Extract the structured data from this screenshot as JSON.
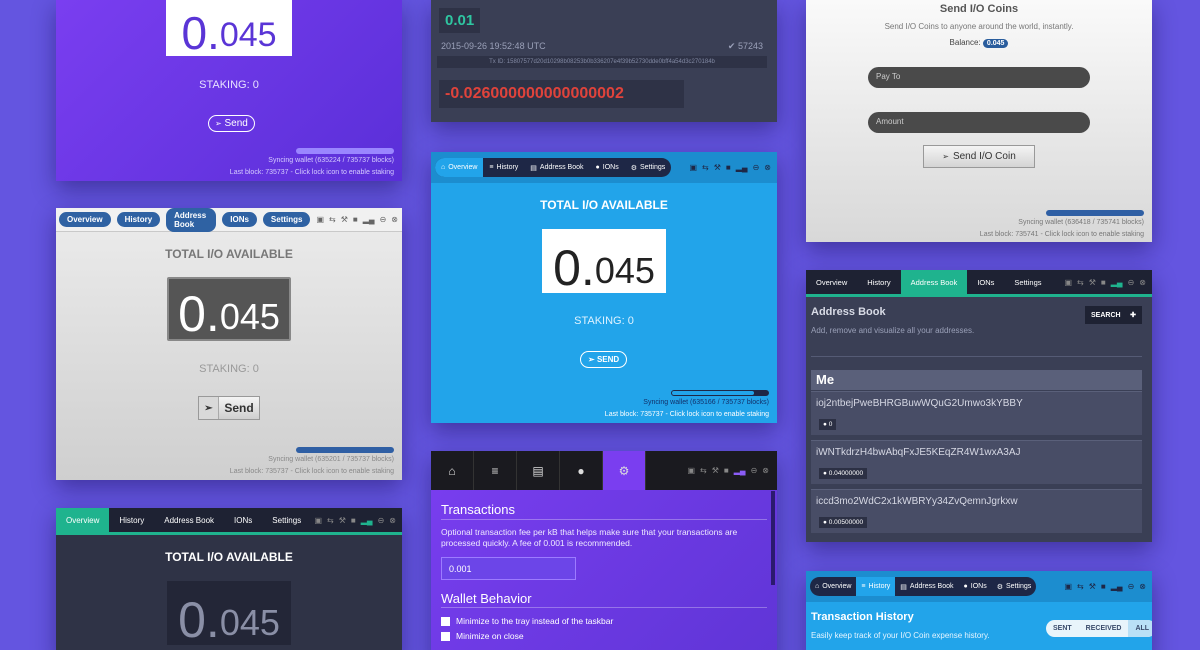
{
  "cardA": {
    "balance_int": "0.",
    "balance_dec": "045",
    "staking": "STAKING: 0",
    "send": "Send",
    "sync_line": "Syncing wallet (635224 / 735737 blocks)",
    "last_block": "Last block: 735737 - Click lock icon to enable staking"
  },
  "cardB": {
    "amount_in": "0.01",
    "datetime": "2015-09-26 19:52:48 UTC",
    "confirmations": "57243",
    "txid": "Tx ID: 15807577d20d10298b08253b0b336207e4f39b52730dde0bff4a54d3c270184b",
    "amount_out": "-0.026000000000000002"
  },
  "cardC": {
    "title": "Send I/O Coins",
    "subtitle": "Send I/O Coins to anyone around the world, instantly.",
    "balance_label": "Balance:",
    "balance_value": "0.045",
    "payto_placeholder": "Pay To",
    "amount_placeholder": "Amount",
    "send_button": "Send I/O Coin",
    "sync_line": "Syncing wallet (636418 / 735741 blocks)",
    "last_block": "Last block: 735741 - Click lock icon to enable staking"
  },
  "cardD": {
    "tabs": [
      "Overview",
      "History",
      "Address Book",
      "IONs",
      "Settings"
    ],
    "title": "TOTAL I/O AVAILABLE",
    "balance_int": "0.",
    "balance_dec": "045",
    "staking": "STAKING: 0",
    "send": "Send",
    "sync_line": "Syncing wallet (635201 / 735737 blocks)",
    "last_block": "Last block: 735737 - Click lock icon to enable staking"
  },
  "cardE": {
    "tabs": [
      "Overview",
      "History",
      "Address Book",
      "IONs",
      "Settings"
    ],
    "title": "TOTAL I/O AVAILABLE",
    "balance_int": "0.",
    "balance_dec": "045",
    "staking": "STAKING: 0",
    "send": "SEND",
    "sync_line": "Syncing wallet (635166 / 735737 blocks)",
    "last_block": "Last block: 735737 - Click lock icon to enable staking"
  },
  "cardF": {
    "tabs": [
      "Overview",
      "History",
      "Address Book",
      "IONs",
      "Settings"
    ],
    "title": "TOTAL I/O AVAILABLE",
    "balance_int": "0.",
    "balance_dec": "045"
  },
  "cardG": {
    "section1": "Transactions",
    "description": "Optional transaction fee per kB that helps make sure that your transactions are processed quickly. A fee of 0.001 is recommended.",
    "fee_value": "0.001",
    "section2": "Wallet Behavior",
    "opt1": "Minimize to the tray instead of the taskbar",
    "opt2": "Minimize on close"
  },
  "cardH": {
    "tabs": [
      "Overview",
      "History",
      "Address Book",
      "IONs",
      "Settings"
    ],
    "title": "Address Book",
    "subtitle": "Add, remove and visualize all your addresses.",
    "search": "SEARCH",
    "me": "Me",
    "entries": [
      {
        "address": "ioj2ntbejPweBHRGBuwWQuG2Umwo3kYBBY",
        "count": "0"
      },
      {
        "address": "iWNTkdrzH4bwAbqFxJE5KEqZR4W1wxA3AJ",
        "count": "0.04000000"
      },
      {
        "address": "iccd3mo2WdC2x1kWBRYy34ZvQemnJgrkxw",
        "count": "0.00500000"
      }
    ]
  },
  "cardI": {
    "tabs": [
      "Overview",
      "History",
      "Address Book",
      "IONs",
      "Settings"
    ],
    "title": "Transaction History",
    "subtitle": "Easily keep track of your I/O Coin expense history.",
    "filters": [
      "SENT",
      "RECEIVED",
      "ALL"
    ]
  },
  "colors": {
    "background": "#6455e0",
    "purple": "#7a3ef0",
    "blue": "#22a4ea",
    "teal": "#1fb38e",
    "navy": "#2f62a3",
    "negative": "#e0433b",
    "positive": "#2fc6a1"
  }
}
